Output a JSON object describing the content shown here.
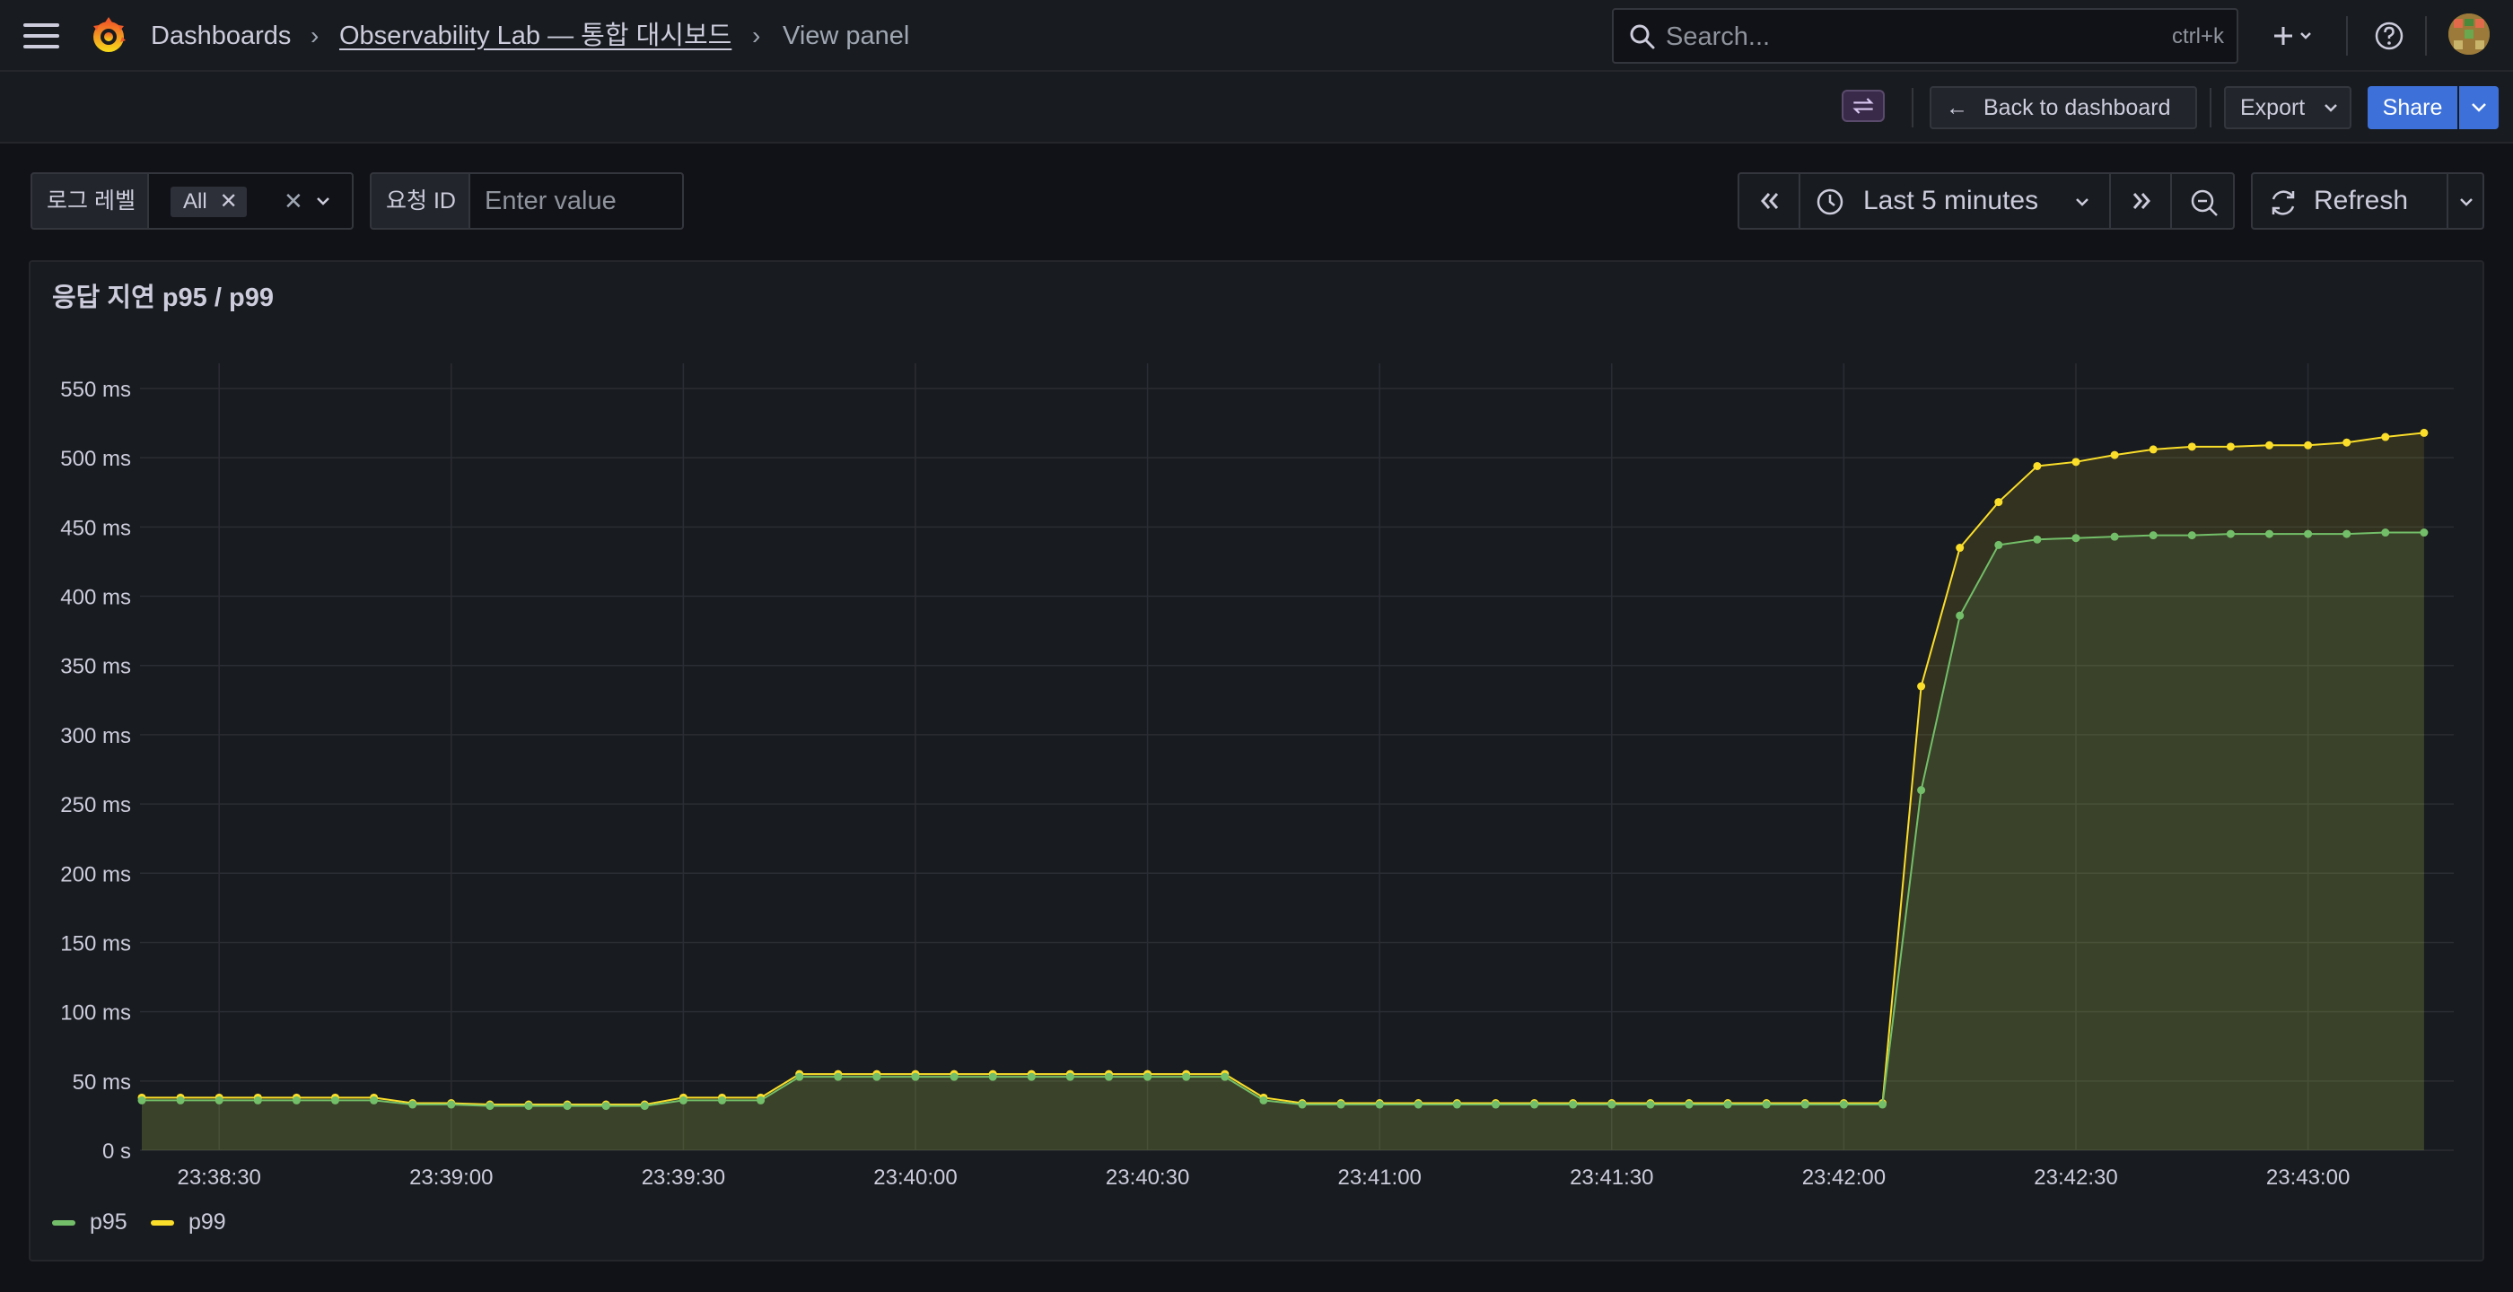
{
  "breadcrumb": {
    "home": "Dashboards",
    "dashboard": "Observability Lab — 통합 대시보드",
    "current": "View panel"
  },
  "search": {
    "placeholder": "Search...",
    "shortcut": "ctrl+k"
  },
  "toolbar": {
    "back_label": "Back to dashboard",
    "export_label": "Export",
    "share_label": "Share"
  },
  "variables": [
    {
      "label": "로그 레벨",
      "value": "All"
    },
    {
      "label": "요청 ID",
      "placeholder": "Enter value"
    }
  ],
  "time_picker": {
    "range_label": "Last 5 minutes",
    "refresh_label": "Refresh"
  },
  "panel": {
    "title": "응답 지연 p95 / p99"
  },
  "colors": {
    "p95": "#73bf69",
    "p99": "#fade2a",
    "accent": "#3d71d9"
  },
  "icons": [
    "menu-icon",
    "grafana-logo",
    "search-icon",
    "plus-icon",
    "help-icon",
    "avatar",
    "swap-icon",
    "arrow-left-icon",
    "chevron-down-icon",
    "chevrons-left-icon",
    "clock-icon",
    "chevrons-right-icon",
    "zoom-out-icon",
    "refresh-icon",
    "close-icon"
  ],
  "chart_data": {
    "type": "line",
    "title": "응답 지연 p95 / p99",
    "x_start": "23:38:20",
    "x_step_seconds": 5,
    "x_tick_labels": [
      "23:38:30",
      "23:39:00",
      "23:39:30",
      "23:40:00",
      "23:40:30",
      "23:41:00",
      "23:41:30",
      "23:42:00",
      "23:42:30",
      "23:43:00"
    ],
    "y_tick_labels": [
      "0 s",
      "50 ms",
      "100 ms",
      "150 ms",
      "200 ms",
      "250 ms",
      "300 ms",
      "350 ms",
      "400 ms",
      "450 ms",
      "500 ms",
      "550 ms"
    ],
    "ylim": [
      0,
      550
    ],
    "y_unit": "ms",
    "grid": true,
    "legend": "bottom-left",
    "series": [
      {
        "name": "p95",
        "color": "#73bf69",
        "values": [
          36,
          36,
          36,
          36,
          36,
          36,
          36,
          33,
          33,
          32,
          32,
          32,
          32,
          32,
          36,
          36,
          36,
          53,
          53,
          53,
          53,
          53,
          53,
          53,
          53,
          53,
          53,
          53,
          53,
          36,
          33,
          33,
          33,
          33,
          33,
          33,
          33,
          33,
          33,
          33,
          33,
          33,
          33,
          33,
          33,
          33,
          260,
          386,
          437,
          441,
          442,
          443,
          444,
          444,
          445,
          445,
          445,
          445,
          446,
          446
        ]
      },
      {
        "name": "p99",
        "color": "#fade2a",
        "values": [
          38,
          38,
          38,
          38,
          38,
          38,
          38,
          34,
          34,
          33,
          33,
          33,
          33,
          33,
          38,
          38,
          38,
          55,
          55,
          55,
          55,
          55,
          55,
          55,
          55,
          55,
          55,
          55,
          55,
          38,
          34,
          34,
          34,
          34,
          34,
          34,
          34,
          34,
          34,
          34,
          34,
          34,
          34,
          34,
          34,
          34,
          335,
          435,
          468,
          494,
          497,
          502,
          506,
          508,
          508,
          509,
          509,
          511,
          515,
          518
        ]
      }
    ]
  }
}
